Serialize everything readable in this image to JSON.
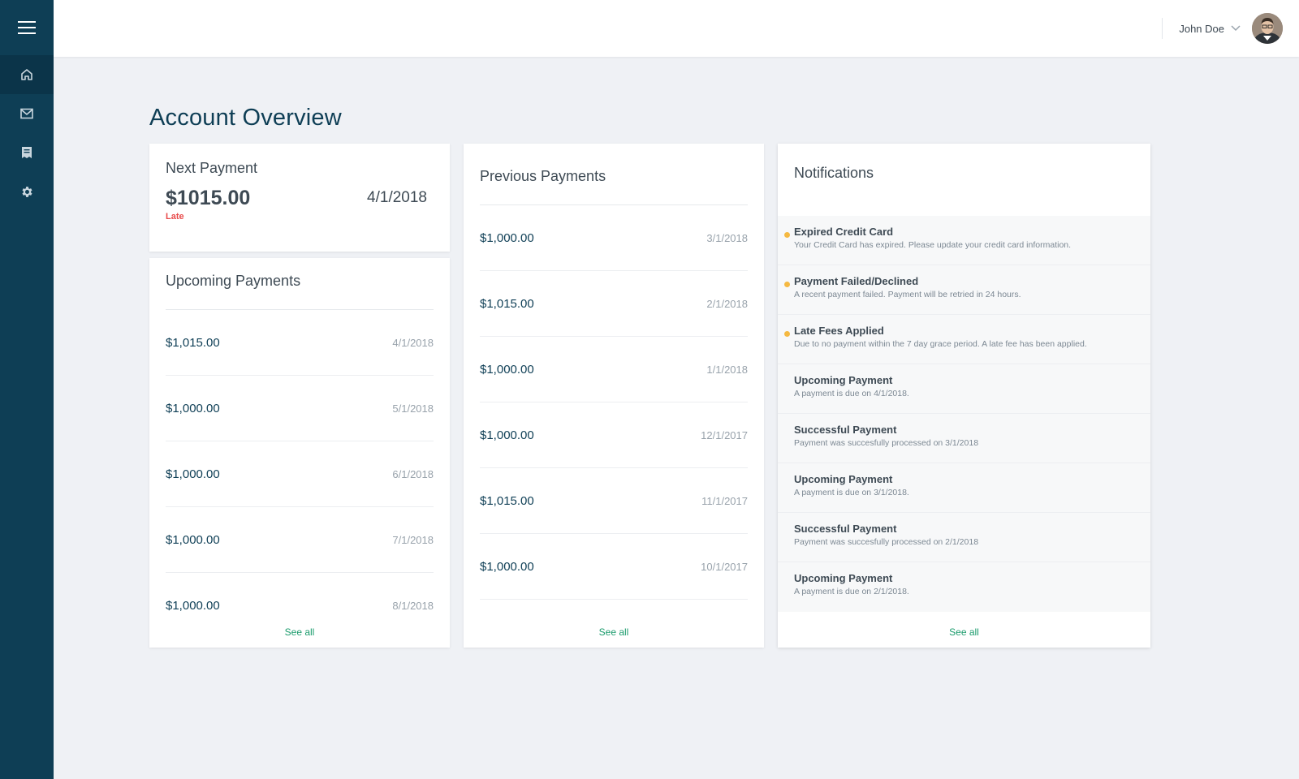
{
  "topbar": {
    "user_name": "John Doe"
  },
  "page": {
    "title": "Account Overview"
  },
  "next_payment": {
    "title": "Next Payment",
    "amount": "$1015.00",
    "date": "4/1/2018",
    "status": "Late"
  },
  "upcoming": {
    "title": "Upcoming Payments",
    "see_all": "See all",
    "rows": [
      {
        "amount": "$1,015.00",
        "date": "4/1/2018"
      },
      {
        "amount": "$1,000.00",
        "date": "5/1/2018"
      },
      {
        "amount": "$1,000.00",
        "date": "6/1/2018"
      },
      {
        "amount": "$1,000.00",
        "date": "7/1/2018"
      },
      {
        "amount": "$1,000.00",
        "date": "8/1/2018"
      }
    ]
  },
  "previous": {
    "title": "Previous Payments",
    "see_all": "See all",
    "rows": [
      {
        "amount": "$1,000.00",
        "date": "3/1/2018"
      },
      {
        "amount": "$1,015.00",
        "date": "2/1/2018"
      },
      {
        "amount": "$1,000.00",
        "date": "1/1/2018"
      },
      {
        "amount": "$1,000.00",
        "date": "12/1/2017"
      },
      {
        "amount": "$1,015.00",
        "date": "11/1/2017"
      },
      {
        "amount": "$1,000.00",
        "date": "10/1/2017"
      }
    ]
  },
  "notifications": {
    "title": "Notifications",
    "see_all": "See all",
    "dot_color": "#f5b942",
    "items": [
      {
        "title": "Expired Credit Card",
        "desc": "Your Credit Card has expired. Please update your credit card information."
      },
      {
        "title": "Payment Failed/Declined",
        "desc": "A recent payment failed. Payment will be retried in 24 hours."
      },
      {
        "title": "Late Fees Applied",
        "desc": "Due to no payment within the 7 day grace period. A late fee has been applied."
      },
      {
        "title": "Upcoming Payment",
        "desc": "A payment is due on 4/1/2018."
      },
      {
        "title": "Successful Payment",
        "desc": "Payment was succesfully processed on 3/1/2018"
      },
      {
        "title": "Upcoming Payment",
        "desc": "A payment is due on 3/1/2018."
      },
      {
        "title": "Successful Payment",
        "desc": "Payment was succesfully processed on 2/1/2018"
      },
      {
        "title": "Upcoming Payment",
        "desc": "A payment is due on 2/1/2018."
      }
    ]
  },
  "colors": {
    "sidebar": "#0e3e55",
    "accent": "#1a9b6c",
    "late": "#e84b4b"
  },
  "icons": [
    "hamburger-icon",
    "home-icon",
    "mail-icon",
    "receipt-icon",
    "gear-icon",
    "chevron-down-icon"
  ]
}
